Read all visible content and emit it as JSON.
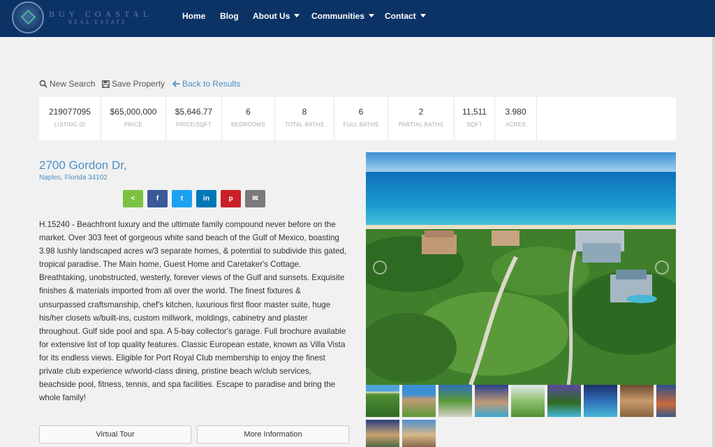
{
  "brand": {
    "name": "BUY COASTAL",
    "tagline": "REAL ESTATE"
  },
  "nav": {
    "home": "Home",
    "blog": "Blog",
    "about": "About Us",
    "communities": "Communities",
    "contact": "Contact"
  },
  "actions": {
    "new_search": "New Search",
    "save_property": "Save Property",
    "back": "Back to Results"
  },
  "stats": [
    {
      "value": "219077095",
      "label": "LISTING ID"
    },
    {
      "value": "$65,000,000",
      "label": "PRICE"
    },
    {
      "value": "$5,646.77",
      "label": "PRICE/SQFT"
    },
    {
      "value": "6",
      "label": "BEDROOMS"
    },
    {
      "value": "8",
      "label": "TOTAL BATHS"
    },
    {
      "value": "6",
      "label": "FULL BATHS"
    },
    {
      "value": "2",
      "label": "PARTIAL BATHS"
    },
    {
      "value": "11,511",
      "label": "SQFT"
    },
    {
      "value": "3.980",
      "label": "ACRES"
    }
  ],
  "property": {
    "address": "2700 Gordon Dr,",
    "city": "Naples, Florida 34102",
    "description": "H.15240 - Beachfront luxury and the ultimate family compound never before on the market. Over 303 feet of gorgeous white sand beach of the Gulf of Mexico, boasting 3.98 lushly landscaped acres w/3 separate homes, & potential to subdivide this gated, tropical paradise. The Main home, Guest Home and Caretaker's Cottage. Breathtaking, unobstructed, westerly, forever views of the Gulf and sunsets. Exquisite finishes & materials imported from all over the world. The finest fixtures & unsurpassed craftsmanship, chef's kitchen, luxurious first floor master suite, huge his/her closets w/built-ins, custom millwork, moldings, cabinetry and plaster throughout. Gulf side pool and spa. A 5-bay collector's garage. Full brochure available for extensive list of top quality features. Classic European estate, known as Villa Vista for its endless views. Eligible for Port Royal Club membership to enjoy the finest private club experience w/world-class dining, pristine beach w/club services, beachside pool, fitness, tennis, and spa facilities. Escape to paradise and bring the whole family!"
  },
  "share": [
    {
      "name": "share-icon",
      "color": "#7cc242",
      "glyph": "<"
    },
    {
      "name": "facebook-icon",
      "color": "#3b5998",
      "glyph": "f"
    },
    {
      "name": "twitter-icon",
      "color": "#1da1f2",
      "glyph": "t"
    },
    {
      "name": "linkedin-icon",
      "color": "#0077b5",
      "glyph": "in"
    },
    {
      "name": "pinterest-icon",
      "color": "#cb2027",
      "glyph": "p"
    },
    {
      "name": "email-icon",
      "color": "#7a7a7a",
      "glyph": "✉"
    }
  ],
  "buttons": {
    "virtual_tour": "Virtual Tour",
    "more_info": "More Information"
  },
  "colors": {
    "header": "#0c3366",
    "link": "#4a90c8",
    "background": "#f1f1f1"
  }
}
